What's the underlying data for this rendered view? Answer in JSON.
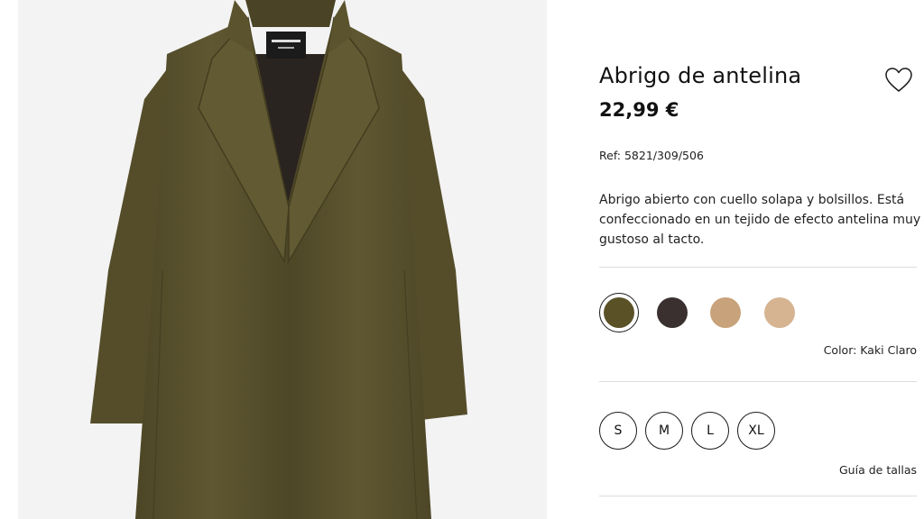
{
  "product": {
    "title": "Abrigo de antelina",
    "price": "22,99 €",
    "ref": "Ref: 5821/309/506",
    "description": "Abrigo abierto con cuello solapa y bolsillos. Está confeccionado en un tejido de efecto antelina muy gustoso al tacto."
  },
  "wishlist": {
    "icon": "heart-outline-icon"
  },
  "colors": {
    "swatches": [
      {
        "hex": "#5a5127",
        "selected": true
      },
      {
        "hex": "#3a3030",
        "selected": false
      },
      {
        "hex": "#c8a27a",
        "selected": false
      },
      {
        "hex": "#d6b492",
        "selected": false
      }
    ],
    "label": "Color: Kaki Claro"
  },
  "sizes": {
    "options": [
      "S",
      "M",
      "L",
      "XL"
    ],
    "guide_label": "Guía de tallas"
  },
  "image": {
    "coat_color": "#5c5430",
    "lining_color": "#2a2420",
    "background": "#f3f3f3"
  }
}
